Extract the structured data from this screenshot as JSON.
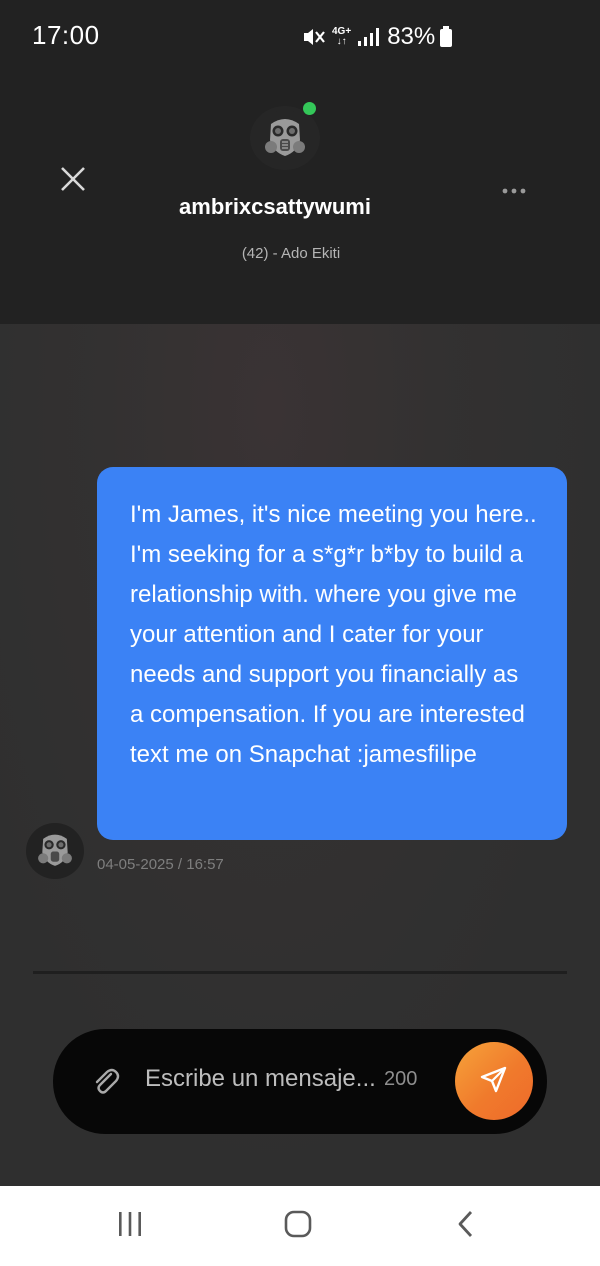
{
  "status_bar": {
    "time": "17:00",
    "network": "4G+",
    "battery": "83%"
  },
  "header": {
    "username": "ambrixcsattywumi",
    "subtitle": "(42) - Ado Ekiti",
    "online": true
  },
  "chat": {
    "messages": [
      {
        "text": "I'm James, it's nice meeting you here.. I'm seeking for a s*g*r b*by to build a relationship with. where you give me your attention and I cater for your needs and support you financially as a compensation. If you are interested text me on Snapchat :jamesfilipe",
        "timestamp": "04-05-2025 / 16:57"
      }
    ]
  },
  "composer": {
    "placeholder": "Escribe un mensaje...",
    "char_limit": "200"
  },
  "icons": {
    "close": "close-icon",
    "more": "more-icon",
    "attach": "paperclip-icon",
    "send": "send-icon",
    "avatar": "gas-mask-avatar-icon",
    "nav_recents": "recents-icon",
    "nav_home": "home-icon",
    "nav_back": "back-icon"
  },
  "colors": {
    "bubble": "#3b82f5",
    "send_button": "#f07a2c",
    "online_dot": "#34c759"
  }
}
